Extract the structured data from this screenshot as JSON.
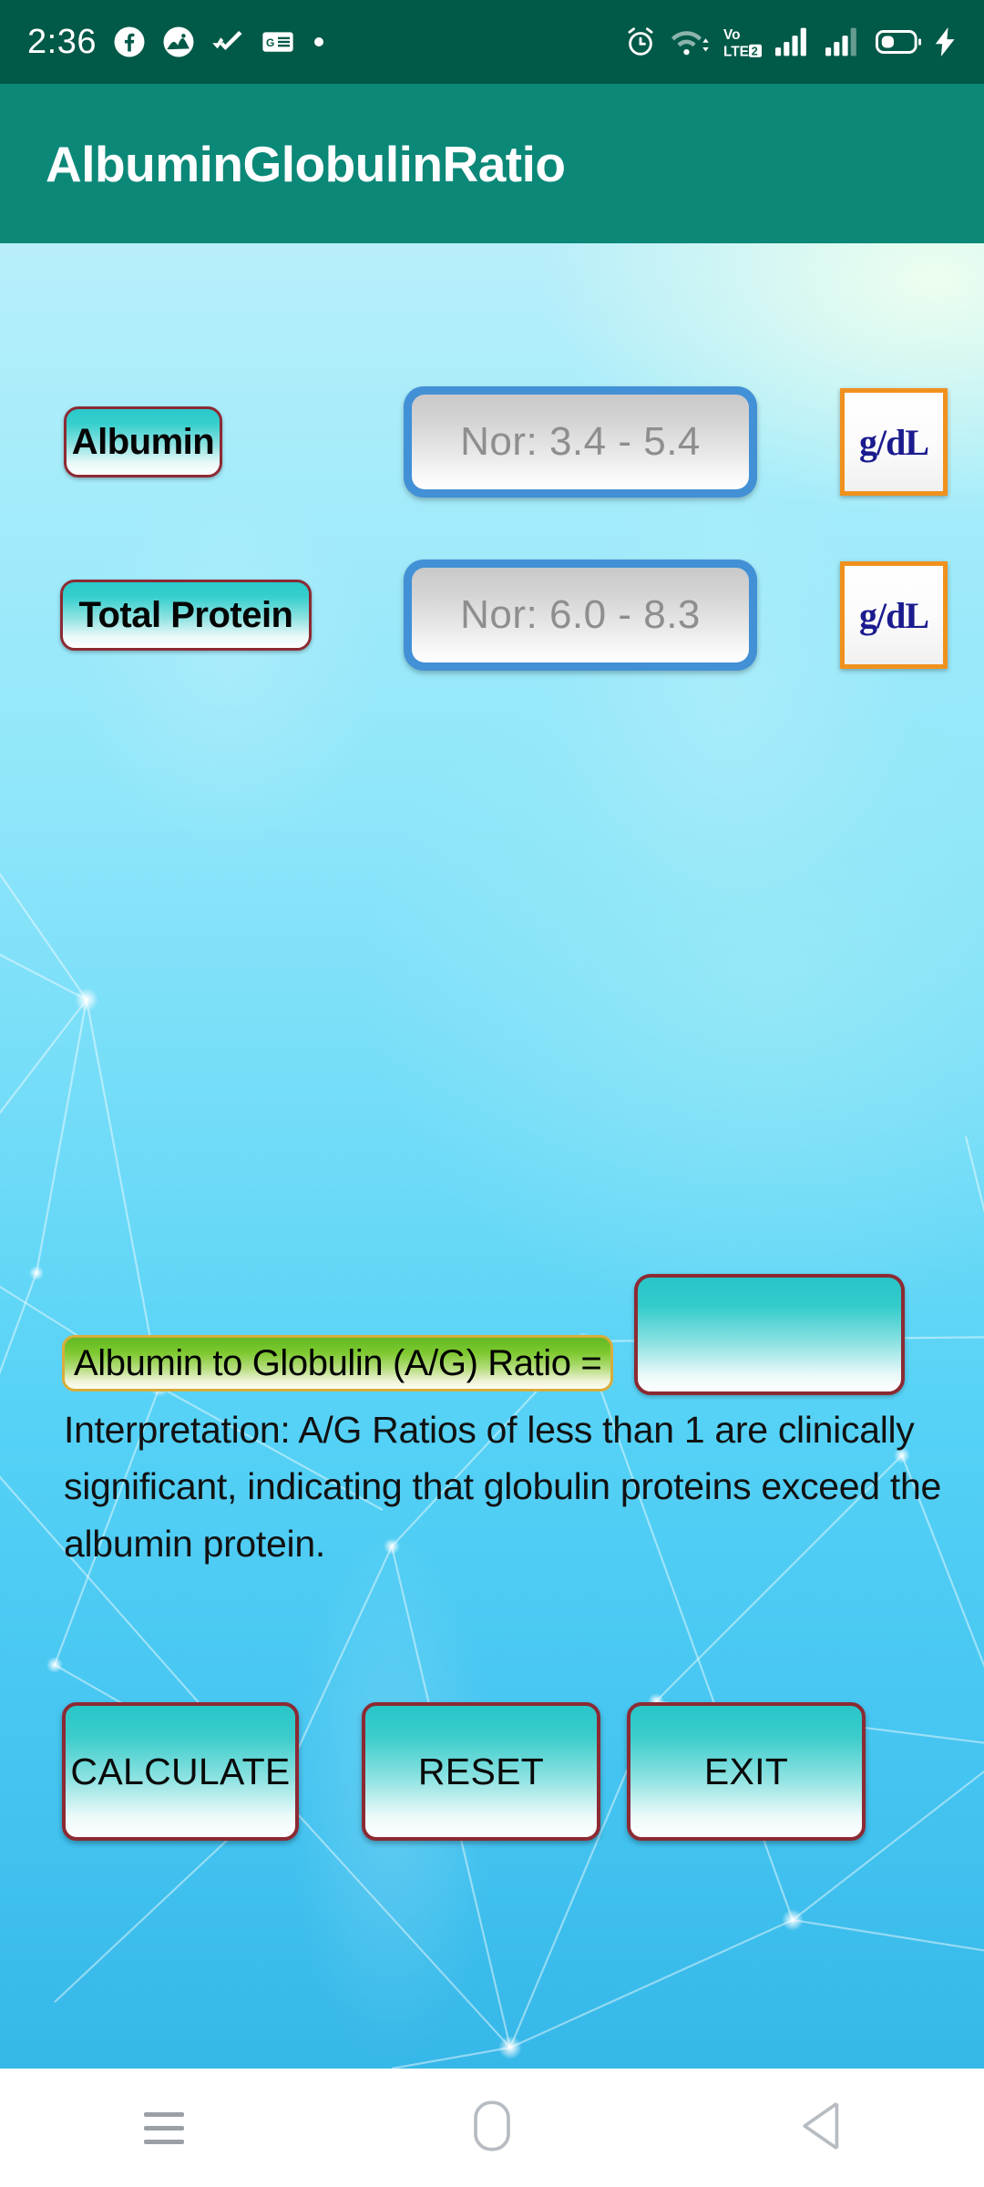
{
  "status_bar": {
    "time": "2:36",
    "left_icons": [
      "facebook-icon",
      "gallery-icon",
      "double-check-icon",
      "google-news-icon",
      "dot-icon"
    ],
    "right_icons": [
      "alarm-icon",
      "wifi-icon",
      "volte-icon",
      "signal-sim1-icon",
      "signal-sim2-icon",
      "battery-icon",
      "charging-bolt-icon"
    ],
    "volte_label": "VoLTE2",
    "background_color": "#015947"
  },
  "app_bar": {
    "title": "AlbuminGlobulinRatio",
    "background_color": "#0c8878",
    "title_color": "#ffffff"
  },
  "form": {
    "rows": [
      {
        "label": "Albumin",
        "placeholder": "Nor: 3.4 - 5.4",
        "value": "",
        "unit": "g/dL"
      },
      {
        "label": "Total Protein",
        "placeholder": "Nor: 6.0 - 8.3",
        "value": "",
        "unit": "g/dL"
      }
    ],
    "input_border_color": "#4290d6",
    "unit_border_color": "#f0911e",
    "label_border_color": "#8c2a33"
  },
  "result": {
    "label": "Albumin to Globulin (A/G) Ratio =",
    "value": "",
    "label_border_color": "#d8ad3c",
    "box_border_color": "#8c2a33",
    "interpretation": "Interpretation: A/G Ratios of less than 1 are clinically significant, indicating that globulin proteins exceed the albumin protein."
  },
  "buttons": {
    "calculate": "CALCULATE",
    "reset": "RESET",
    "exit": "EXIT"
  },
  "nav_bar": {
    "recents": "recents-icon",
    "home": "home-icon",
    "back": "back-icon"
  }
}
